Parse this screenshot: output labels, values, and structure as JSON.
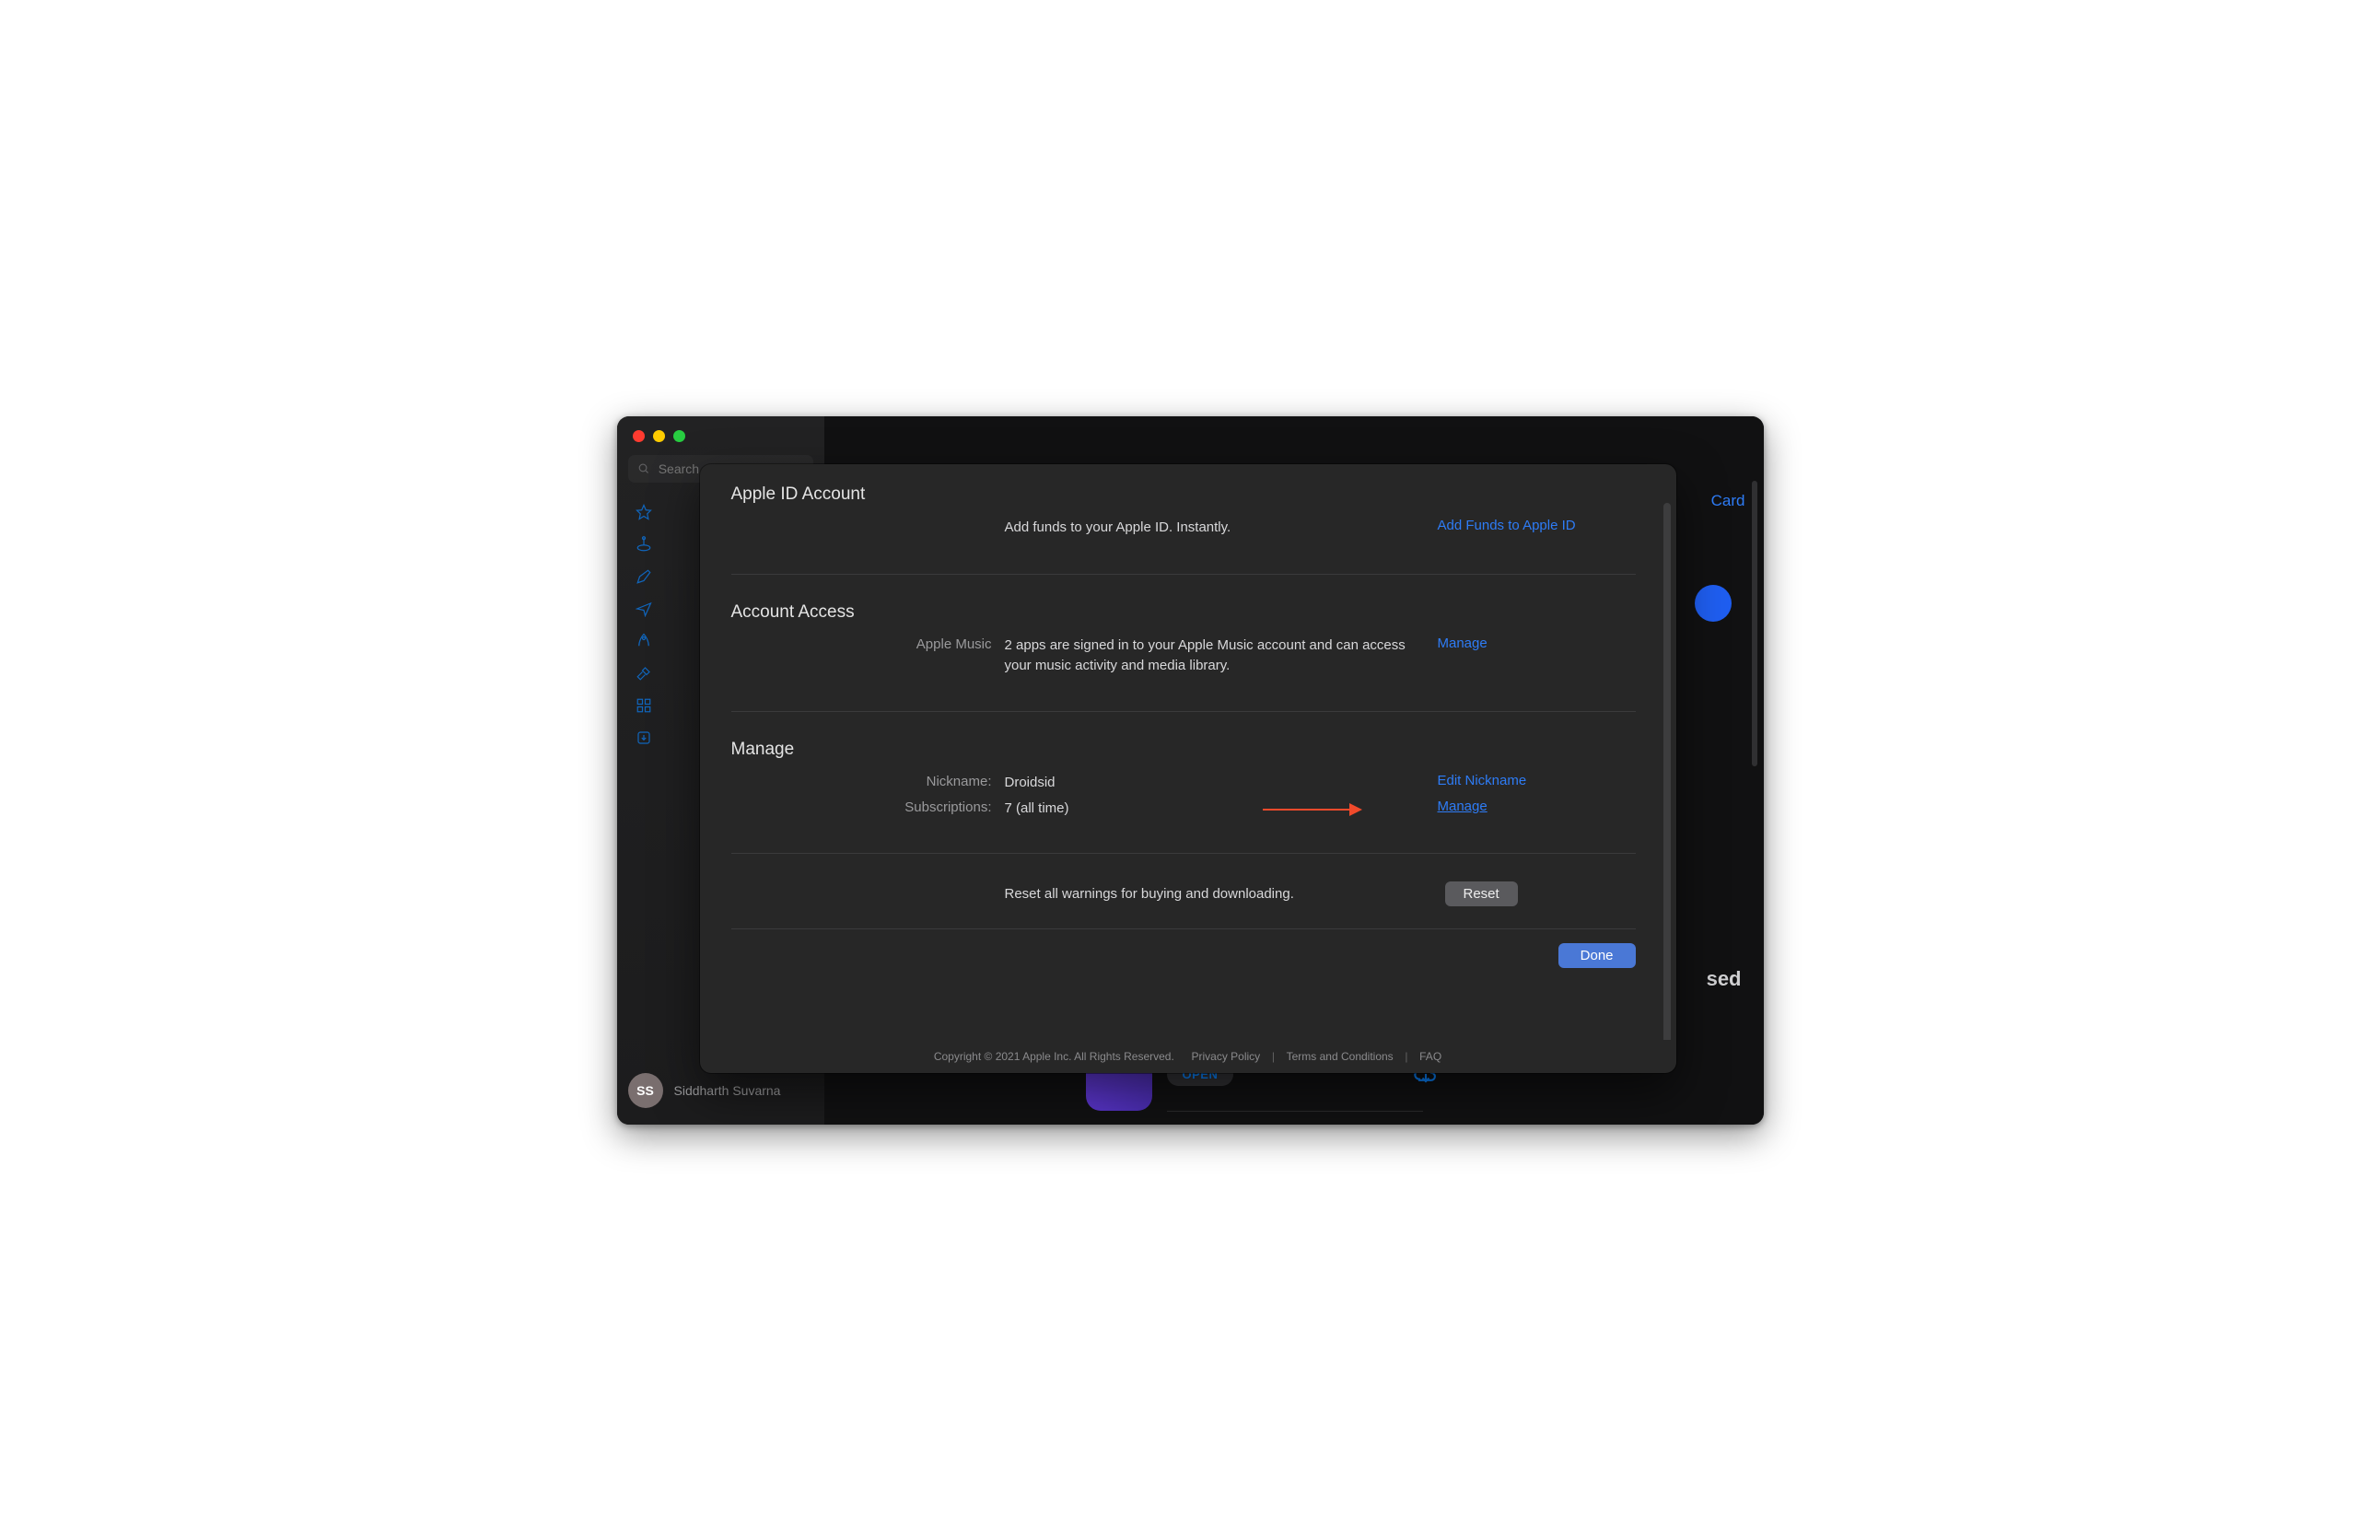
{
  "sidebar": {
    "search_placeholder": "Search",
    "user": {
      "initials": "SS",
      "name": "Siddharth Suvarna"
    }
  },
  "background": {
    "card_link": "Card",
    "based_text": "sed",
    "open_label": "OPEN"
  },
  "modal": {
    "sections": {
      "apple_id": {
        "title": "Apple ID Account",
        "desc": "Add funds to your Apple ID. Instantly.",
        "action": "Add Funds to Apple ID"
      },
      "access": {
        "title": "Account Access",
        "label": "Apple Music",
        "desc": "2 apps are signed in to your Apple Music account and can access your music activity and media library.",
        "action": "Manage"
      },
      "manage": {
        "title": "Manage",
        "nickname_label": "Nickname:",
        "nickname_value": "Droidsid",
        "nickname_action": "Edit Nickname",
        "subs_label": "Subscriptions:",
        "subs_value": "7 (all time)",
        "subs_action": "Manage",
        "reset_desc": "Reset all warnings for buying and downloading.",
        "reset_btn": "Reset"
      },
      "done_btn": "Done"
    },
    "footer": {
      "copyright": "Copyright © 2021 Apple Inc. All Rights Reserved.",
      "privacy": "Privacy Policy",
      "terms": "Terms and Conditions",
      "faq": "FAQ"
    }
  }
}
